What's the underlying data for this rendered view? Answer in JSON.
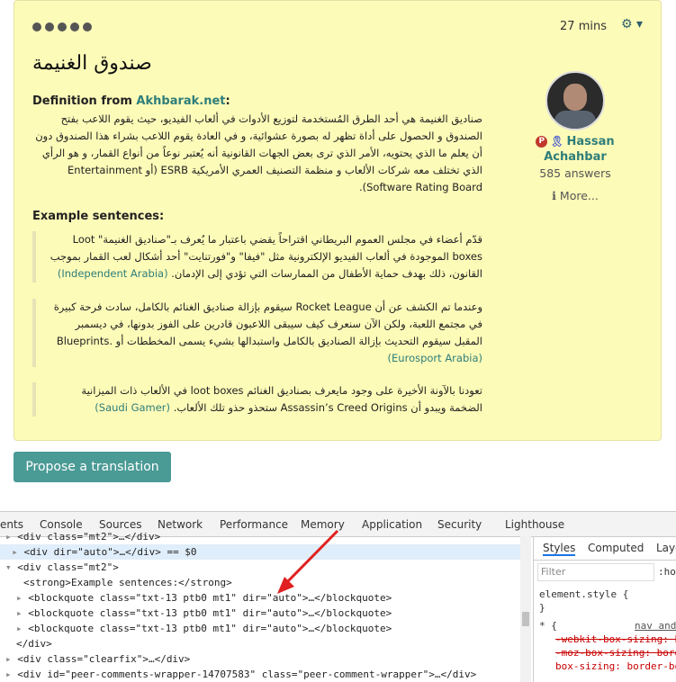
{
  "card": {
    "time": "27 mins",
    "word": "صندوق الغنيمة",
    "definition_prefix": "Definition from ",
    "definition_source": "Akhbarak.net",
    "definition_suffix": ":",
    "definition_text": "صناديق الغنيمة هي أحد الطرق المُستخدمة لتوزيع الأدوات في ألعاب الفيديو، حيث يقوم اللاعب بفتح الصندوق و الحصول على أداة تظهر له بصورة عشوائية، و في العادة يقوم اللاعب بشراء هذا الصندوق دون أن يعلم ما الذي يحتويه، الأمر الذي ترى بعض الجهات القانونية أنه يُعتبر نوعاً من أنواع القمار، و هو الرأي الذي تختلف معه شركات الألعاب و منظمة التصنيف العمري الأمريكية ESRB (أو Entertainment Software Rating Board).",
    "examples_heading": "Example sentences:",
    "examples": [
      {
        "text": "قدّم أعضاء في مجلس العموم البريطاني اقتراحاً يقضي باعتبار ما يُعرف بـ\"صناديق الغنيمة\" Loot boxes الموجودة في ألعاب الفيديو الإلكترونية مثل \"فيفا\" و\"فورتنايت\" أحد أشكال لعب القمار بموجب القانون، ذلك بهدف حماية الأطفال من الممارسات التي تؤدي إلى الإدمان.",
        "source": "(Independent Arabia)"
      },
      {
        "text": "وعندما تم الكشف عن أن Rocket League سيقوم بإزالة صناديق الغنائم بالكامل، سادت فرحة كبيرة في مجتمع اللعبة، ولكن الآن سنعرف كيف سيبقى اللاعبون قادرين على الفوز بدونها، في ديسمبر المقبل سيقوم التحديث بإزالة الصناديق بالكامل واستبدالها بشيء يسمى المخططات أو .Blueprints",
        "source": "(Eurosport Arabia)"
      },
      {
        "text": "تعودنا بالآونة الأخيرة على وجود مايعرف بصناديق الغنائم loot boxes في الألعاب ذات الميزانية الضخمة ويبدو أن Assassin’s Creed Origins ستحذو حذو تلك الألعاب.",
        "source": "(Saudi Gamer)"
      }
    ]
  },
  "profile": {
    "badge": "P",
    "name_line1": "Hassan",
    "name_line2": "Achahbar",
    "answers": "585 answers",
    "more": "More..."
  },
  "propose_button": "Propose a translation",
  "devtools": {
    "tabs": [
      "ents",
      "Console",
      "Sources",
      "Network",
      "Performance",
      "Memory",
      "Application",
      "Security",
      "Lighthouse"
    ],
    "side_tabs": [
      "Styles",
      "Computed",
      "Layo"
    ],
    "filter_placeholder": "Filter",
    "hov": ":ho",
    "element_style": "element.style {",
    "close_brace": "}",
    "rule_open": "* {",
    "rule_source": "nav and",
    "rule_webkit": "-webkit-box-sizing: b",
    "rule_moz": "-moz-box-sizing: bord",
    "rule_box": "box-sizing: border-bo",
    "dom_lines": [
      "<div class=\"mt2\">…</div>",
      "<div dir=\"auto\">…</div> == $0",
      "<div class=\"mt2\">",
      "<strong>Example sentences:</strong>",
      "<blockquote class=\"txt-13 ptb0 mt1\" dir=\"auto\">…</blockquote>",
      "<blockquote class=\"txt-13 ptb0 mt1\" dir=\"auto\">…</blockquote>",
      "<blockquote class=\"txt-13 ptb0 mt1\" dir=\"auto\">…</blockquote>",
      "</div>",
      "<div class=\"clearfix\">…</div>",
      "<div id=\"peer-comments-wrapper-14707583\" class=\"peer-comment-wrapper\">…</div>"
    ]
  }
}
